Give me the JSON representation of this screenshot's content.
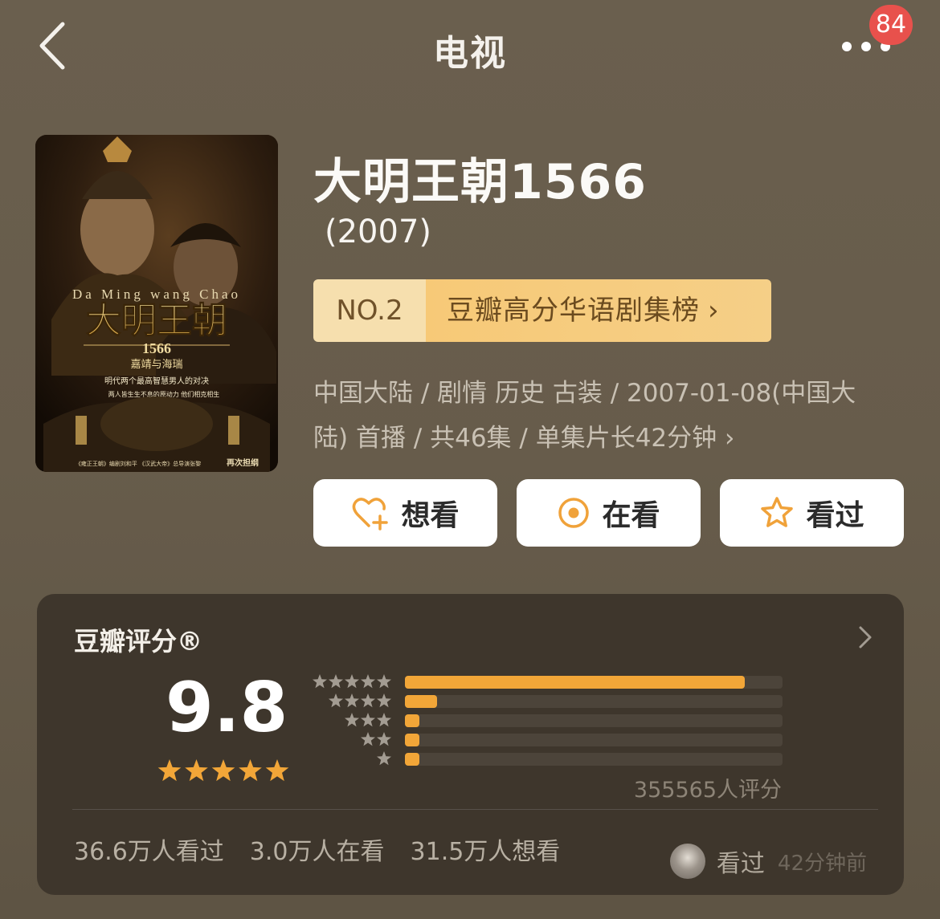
{
  "nav": {
    "title": "电视",
    "badge": "84",
    "back_icon": "chevron-left-icon",
    "more_icon": "more-dots-icon"
  },
  "poster": {
    "title_pinyin": "Da Ming wang Chao",
    "title_cn": "大明王朝",
    "year_num": "1566",
    "subtitle": "嘉靖与海瑞",
    "tagline_1": "明代两个最高智慧男人的对决",
    "tagline_2": "两人皆生生不息的原动力  他们相克相生",
    "credits": "《雍正王朝》编剧刘和平 《汉武大帝》总导演张黎",
    "credits_2": "再次担纲"
  },
  "show": {
    "title": "大明王朝1566",
    "year": "(2007)"
  },
  "rank": {
    "number": "NO.2",
    "list_name": "豆瓣高分华语剧集榜",
    "chevron": "›"
  },
  "meta": {
    "line1": "中国大陆 / 剧情 历史 古装 / 2007-01-08(中国大",
    "line2": "陆) 首播 / 共46集 / 单集片长42分钟",
    "chevron": "›"
  },
  "actions": [
    {
      "label": "想看",
      "icon": "heart-plus-icon"
    },
    {
      "label": "在看",
      "icon": "target-circle-icon"
    },
    {
      "label": "看过",
      "icon": "star-outline-icon"
    }
  ],
  "rating": {
    "title": "豆瓣评分®",
    "score": "9.8",
    "stars": 5,
    "count": "355565人评分",
    "distribution": [
      {
        "stars": 5,
        "fraction": 0.9
      },
      {
        "stars": 4,
        "fraction": 0.085
      },
      {
        "stars": 3,
        "fraction": 0.035
      },
      {
        "stars": 2,
        "fraction": 0.035
      },
      {
        "stars": 1,
        "fraction": 0.035
      }
    ],
    "colors": {
      "accent": "#f2a638",
      "track": "#4c443a",
      "star_gray": "#a39c92"
    }
  },
  "stats": {
    "watched": "36.6万人看过",
    "watching": "3.0万人在看",
    "want": "31.5万人想看"
  },
  "friend": {
    "action": "看过",
    "time": "42分钟前"
  }
}
